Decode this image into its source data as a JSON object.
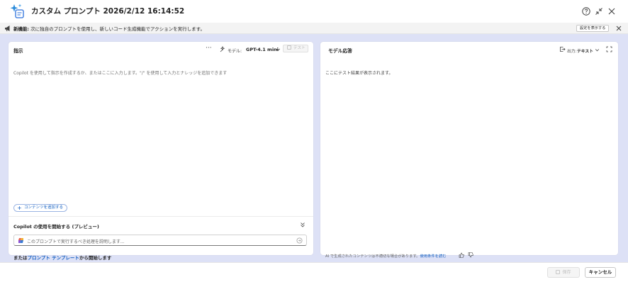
{
  "header": {
    "title": "カスタム プロンプト 2026/2/12 16:14:52"
  },
  "banner": {
    "title": "新機能:",
    "message": " 次に独自のプロンプトを使用し、新しいコード生成機能でアクションを実行します。",
    "button_label": "設定を表示する"
  },
  "instructions": {
    "label": "指示",
    "more_label": "···",
    "model_label": "モデル:",
    "model_value": "GPT-4.1 mini",
    "test_label": "テスト",
    "placeholder": "Copilot を使用して指示を作成するか、またはここに入力します。\"/\" を使用して入力とナレッジを追加できます",
    "add_content_label": "コンテンツを追加する"
  },
  "copilot": {
    "title": "Copilot の使用を開始する (プレビュー)",
    "input_placeholder": "このプロンプトで実行するべき処理を説明します...",
    "template_prefix": "または",
    "template_link": "プロンプト テンプレート",
    "template_suffix": "から開始します"
  },
  "response": {
    "label": "モデル応答",
    "output_label": "出力:",
    "output_value": "テキスト",
    "placeholder": "ここにテスト結果が表示されます。",
    "disclaimer": "AI で生成されたコンテンツは不適切な場合があります。",
    "terms_link": "使用条件を読む"
  },
  "footer": {
    "save_label": "保存",
    "cancel_label": "キャンセル"
  },
  "colors": {
    "accent": "#0f5cc0",
    "workspace_bg": "#dde1f6",
    "banner_bg": "#f3f3f3"
  },
  "icons": [
    "app-sparkle-icon",
    "help-icon",
    "collapse-window-icon",
    "close-icon",
    "megaphone-icon",
    "model-icon",
    "chevron-down-icon",
    "test-icon",
    "plus-icon",
    "copilot-icon",
    "send-icon",
    "output-icon",
    "expand-icon",
    "thumbs-up-icon",
    "thumbs-down-icon",
    "save-icon"
  ]
}
